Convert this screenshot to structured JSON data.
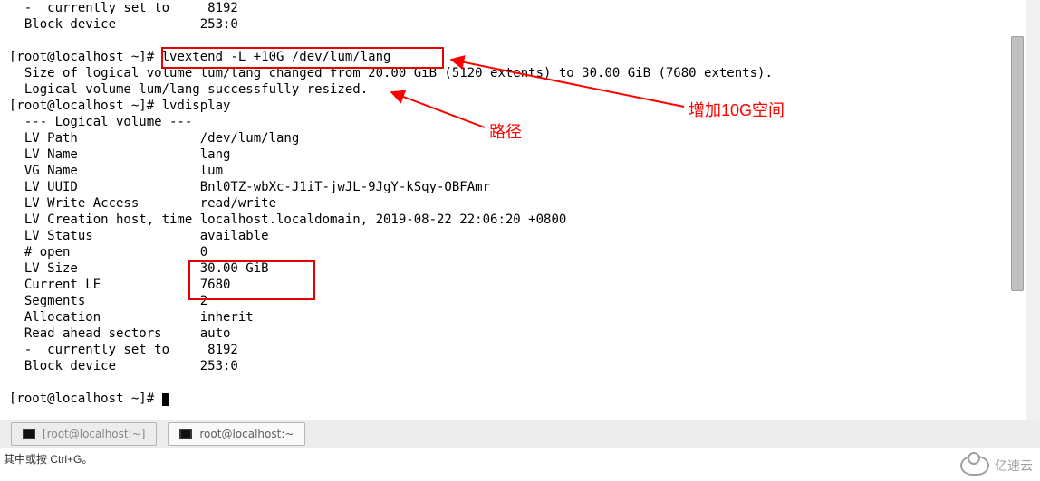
{
  "terminal": {
    "lines": {
      "l0": "  -  currently set to     8192",
      "l1": "  Block device           253:0",
      "l2": "",
      "l3a": "[root@localhost ~]#",
      "l3b": " lvextend -L +10G /dev/lum/lang",
      "l4": "  Size of logical volume lum/lang changed from 20.00 GiB (5120 extents) to 30.00 GiB (7680 extents).",
      "l5": "  Logical volume lum/lang successfully resized.",
      "l6": "[root@localhost ~]# lvdisplay",
      "l7": "  --- Logical volume ---",
      "l8": "  LV Path                /dev/lum/lang",
      "l9": "  LV Name                lang",
      "l10": "  VG Name                lum",
      "l11": "  LV UUID                Bnl0TZ-wbXc-J1iT-jwJL-9JgY-kSqy-OBFAmr",
      "l12": "  LV Write Access        read/write",
      "l13": "  LV Creation host, time localhost.localdomain, 2019-08-22 22:06:20 +0800",
      "l14": "  LV Status              available",
      "l15": "  # open                 0",
      "l16": "  LV Size                30.00 GiB",
      "l17": "  Current LE             7680",
      "l18": "  Segments               2",
      "l19": "  Allocation             inherit",
      "l20": "  Read ahead sectors     auto",
      "l21": "  -  currently set to     8192",
      "l22": "  Block device           253:0",
      "l23": "",
      "l24": "[root@localhost ~]# "
    }
  },
  "annotations": {
    "path_label": "路径",
    "add_space_label": "增加10G空间"
  },
  "tabs": {
    "inactive_label": "[root@localhost:~]",
    "active_label": "root@localhost:~"
  },
  "statusbar": {
    "hint": "其中或按 Ctrl+G。"
  },
  "watermark": {
    "text": "亿速云"
  }
}
